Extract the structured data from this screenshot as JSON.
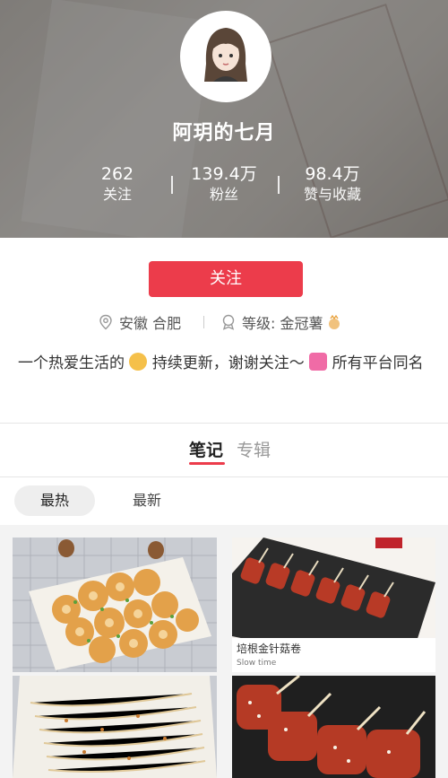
{
  "profile": {
    "nickname": "阿玥的七月",
    "stats": [
      {
        "value": "262",
        "label": "关注"
      },
      {
        "value": "139.4万",
        "label": "粉丝"
      },
      {
        "value": "98.4万",
        "label": "赞与收藏"
      }
    ],
    "follow_label": "关注",
    "location": "安徽 合肥",
    "level": "等级: 金冠薯",
    "bio_part1": "一个热爱生活的",
    "bio_part2": " 持续更新，谢谢关注～ ",
    "bio_part3": "所有平台同名"
  },
  "tabs": {
    "notes": "笔记",
    "albums": "专辑"
  },
  "sort": {
    "hot": "最热",
    "new": "最新"
  },
  "cards": {
    "card2_caption": "培根金针菇卷",
    "card2_subcaption": "Slow time"
  },
  "colors": {
    "accent": "#ec3c4b"
  }
}
